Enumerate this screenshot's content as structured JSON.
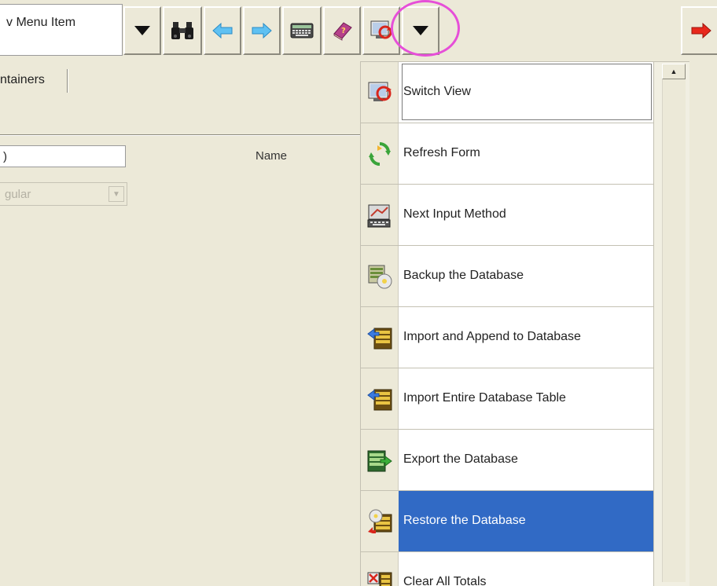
{
  "toolbar": {
    "menu_combo_text": "v Menu Item",
    "buttons": [
      {
        "name": "dropdown-arrow-button",
        "icon": "triangle-down-icon"
      },
      {
        "name": "find-button",
        "icon": "binoculars-icon"
      },
      {
        "name": "back-button",
        "icon": "arrow-left-icon"
      },
      {
        "name": "forward-button",
        "icon": "arrow-right-icon"
      },
      {
        "name": "keyboard-button",
        "icon": "keyboard-icon"
      },
      {
        "name": "help-book-button",
        "icon": "book-icon"
      },
      {
        "name": "switch-view-button",
        "icon": "switch-view-icon"
      },
      {
        "name": "view-menu-dropdown-button",
        "icon": "triangle-down-icon"
      },
      {
        "name": "next-record-button",
        "icon": "red-arrow-right-icon"
      }
    ],
    "highlight_color": "#e64fd8"
  },
  "form": {
    "tab_label": "ntainers",
    "field_value": ")",
    "name_label": "Name",
    "select_value": "gular"
  },
  "menu": {
    "items": [
      {
        "label": "Switch View",
        "icon": "switch-view-icon",
        "state": "focused"
      },
      {
        "label": "Refresh Form",
        "icon": "refresh-icon",
        "state": "normal"
      },
      {
        "label": "Next Input Method",
        "icon": "input-method-icon",
        "state": "normal"
      },
      {
        "label": "Backup the Database",
        "icon": "backup-database-icon",
        "state": "normal"
      },
      {
        "label": "Import and Append to Database",
        "icon": "import-append-icon",
        "state": "normal"
      },
      {
        "label": "Import Entire Database Table",
        "icon": "import-table-icon",
        "state": "normal"
      },
      {
        "label": "Export the Database",
        "icon": "export-database-icon",
        "state": "normal"
      },
      {
        "label": "Restore the Database",
        "icon": "restore-database-icon",
        "state": "selected"
      },
      {
        "label": "Clear All Totals",
        "icon": "clear-totals-icon",
        "state": "normal"
      }
    ],
    "selected_color": "#316ac5"
  }
}
